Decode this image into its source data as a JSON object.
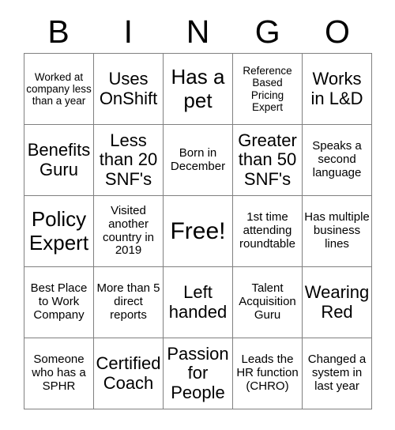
{
  "card": {
    "header_letters": [
      "B",
      "I",
      "N",
      "G",
      "O"
    ],
    "border_color": "#808080",
    "background_color": "#ffffff",
    "text_color": "#000000",
    "grid_rows": 5,
    "grid_cols": 5,
    "cells": [
      {
        "text": "Worked at company less than a year",
        "size": "xs"
      },
      {
        "text": "Uses OnShift",
        "size": "lg"
      },
      {
        "text": "Has a pet",
        "size": "xl"
      },
      {
        "text": "Reference Based Pricing Expert",
        "size": "xs"
      },
      {
        "text": "Works in L&D",
        "size": "lg"
      },
      {
        "text": "Benefits Guru",
        "size": "lg"
      },
      {
        "text": "Less than 20 SNF's",
        "size": "lg"
      },
      {
        "text": "Born in December",
        "size": "sm"
      },
      {
        "text": "Greater than 50 SNF's",
        "size": "lg"
      },
      {
        "text": "Speaks a second language",
        "size": "sm"
      },
      {
        "text": "Policy Expert",
        "size": "xl"
      },
      {
        "text": "Visited another country in 2019",
        "size": "sm"
      },
      {
        "text": "Free!",
        "size": "xxl"
      },
      {
        "text": "1st time attending roundtable",
        "size": "sm"
      },
      {
        "text": "Has multiple business lines",
        "size": "sm"
      },
      {
        "text": "Best Place to Work Company",
        "size": "sm"
      },
      {
        "text": "More than 5 direct reports",
        "size": "sm"
      },
      {
        "text": "Left handed",
        "size": "lg"
      },
      {
        "text": "Talent Acquisition Guru",
        "size": "sm"
      },
      {
        "text": "Wearing Red",
        "size": "lg"
      },
      {
        "text": "Someone who has a SPHR",
        "size": "sm"
      },
      {
        "text": "Certified Coach",
        "size": "lg"
      },
      {
        "text": "Passion for People",
        "size": "lg"
      },
      {
        "text": "Leads the HR function (CHRO)",
        "size": "sm"
      },
      {
        "text": "Changed a system in last year",
        "size": "sm"
      }
    ]
  }
}
